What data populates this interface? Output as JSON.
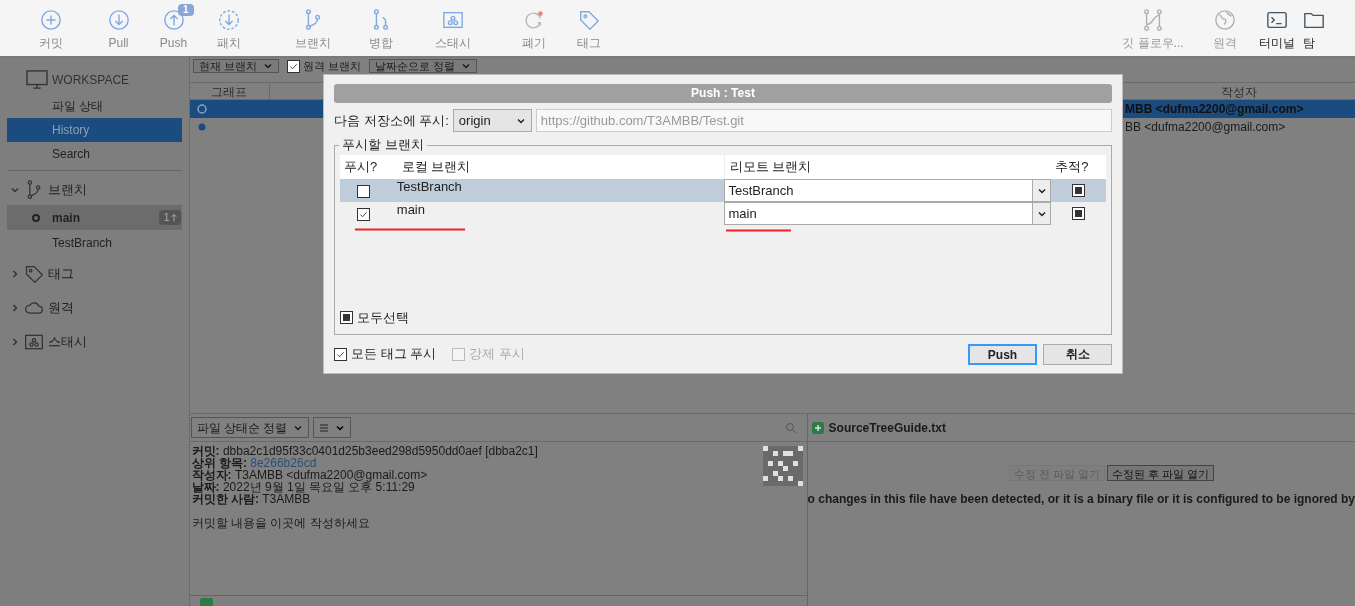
{
  "toolbar": {
    "left": [
      {
        "label": "커밋"
      },
      {
        "label": "Pull"
      },
      {
        "label": "Push",
        "badge": "1"
      },
      {
        "label": "패치"
      },
      {
        "label": "브랜치"
      },
      {
        "label": "병합"
      },
      {
        "label": "스태시"
      },
      {
        "label": "폐기"
      },
      {
        "label": "태그"
      }
    ],
    "right": [
      {
        "label": "깃 플로우...",
        "disabled": true
      },
      {
        "label": "원격",
        "disabled": true
      },
      {
        "label": "터미널",
        "disabled": false
      },
      {
        "label": "탐",
        "disabled": false
      }
    ]
  },
  "sidebar": {
    "workspace": {
      "title": "WORKSPACE",
      "items": [
        {
          "label": "파일 상태",
          "selected": false
        },
        {
          "label": "History",
          "selected": true
        },
        {
          "label": "Search",
          "selected": false
        }
      ]
    },
    "sections": [
      {
        "label": "브랜치",
        "expanded": true,
        "children": [
          {
            "label": "main",
            "selected": true,
            "current": true,
            "badge": "1"
          },
          {
            "label": "TestBranch",
            "selected": false,
            "current": false
          }
        ]
      },
      {
        "label": "태그",
        "expanded": false
      },
      {
        "label": "원격",
        "expanded": false
      },
      {
        "label": "스태시",
        "expanded": false
      }
    ]
  },
  "filter_bar": {
    "branch_select": "현재 브랜치",
    "remote_branches": {
      "label": "원격 브랜치",
      "checked": true
    },
    "sort_select": "날짜순으로 정렬"
  },
  "commit_table": {
    "columns": [
      "그래프",
      "작성자"
    ],
    "rows": [
      {
        "author": "MBB <dufma2200@gmail.com>",
        "selected": true
      },
      {
        "author": "BB <dufma2200@gmail.com>",
        "selected": false
      }
    ]
  },
  "details": {
    "sort_select": "파일 상태순 정렬",
    "lines": [
      {
        "label": "커밋:",
        "value": "dbba2c1d95f33c0401d25b3eed298d5950dd0aef [dbba2c1]",
        "kind": "text"
      },
      {
        "label": "상위 항목:",
        "value": "8e266b26cd",
        "kind": "link"
      },
      {
        "label": "작성자:",
        "value": "T3AMBB <dufma2200@gmail.com>",
        "kind": "text"
      },
      {
        "label": "날짜:",
        "value": "2022년 9월 1일 목요일 오후 5:11:29",
        "kind": "text"
      },
      {
        "label": "커밋한 사람:",
        "value": "T3AMBB",
        "kind": "text"
      }
    ],
    "message": "커밋할 내용을 이곳에 작성하세요"
  },
  "diff": {
    "file": "SourceTreeGuide.txt",
    "buttons": [
      {
        "label": "수정 전 파일 열기",
        "disabled": true
      },
      {
        "label": "수정된 후 파일 열기",
        "disabled": false
      }
    ],
    "message": "o changes in this file have been detected, or it is a binary file or it is configured to be ignored by"
  },
  "dialog": {
    "title": "Push :  Test",
    "repo_label": "다음 저장소에 푸시:",
    "remote": "origin",
    "url": "https://github.com/T3AMBB/Test.git",
    "group_title": "푸시할 브랜치",
    "columns": [
      "푸시?",
      "로컬 브랜치",
      "리모트 브랜치",
      "추적?"
    ],
    "rows": [
      {
        "push": false,
        "local": "TestBranch",
        "remote": "TestBranch",
        "track": true,
        "selected": true,
        "underlined": false
      },
      {
        "push": true,
        "local": "main",
        "remote": "main",
        "track": true,
        "selected": false,
        "underlined": true
      }
    ],
    "select_all": {
      "label": "모두선택",
      "checked": true
    },
    "options": [
      {
        "label": "모든 태그 푸시",
        "checked": true,
        "disabled": false
      },
      {
        "label": "강제 푸시",
        "checked": false,
        "disabled": true
      }
    ],
    "buttons": [
      {
        "label": "Push",
        "default": true
      },
      {
        "label": "취소",
        "default": false
      }
    ]
  }
}
